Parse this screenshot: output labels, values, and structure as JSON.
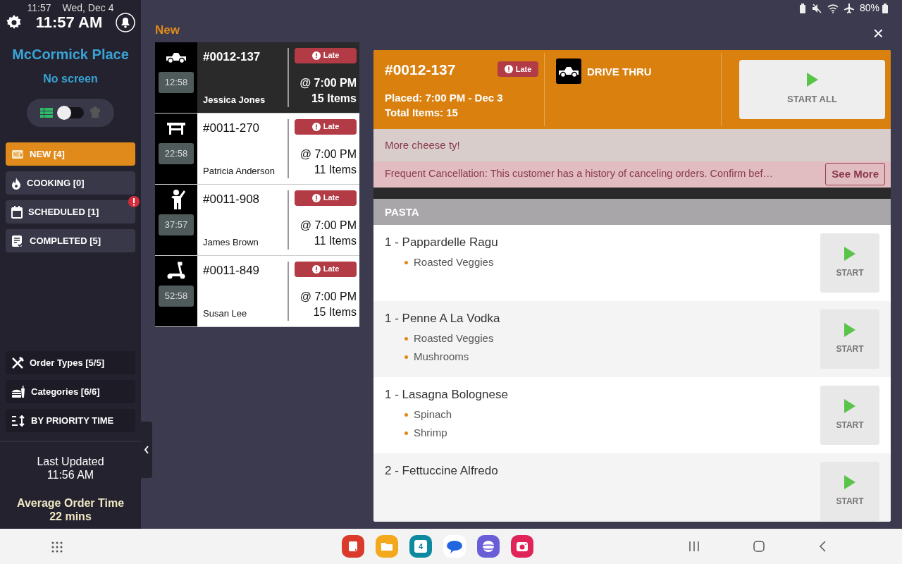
{
  "status_bar": {
    "time": "11:57",
    "date": "Wed, Dec 4",
    "battery": "80%"
  },
  "header": {
    "clock": "11:57 AM",
    "location": "McCormick Place",
    "screen": "No screen",
    "view_toggle": {
      "on": false
    }
  },
  "nav": [
    {
      "kind": "new",
      "label": "NEW [4]",
      "selected": true,
      "alert": false
    },
    {
      "kind": "cooking",
      "label": "COOKING [0]",
      "selected": false,
      "alert": false
    },
    {
      "kind": "scheduled",
      "label": "SCHEDULED [1]",
      "selected": false,
      "alert": true
    },
    {
      "kind": "completed",
      "label": "COMPLETED [5]",
      "selected": false,
      "alert": false
    }
  ],
  "filters": [
    {
      "kind": "order-types",
      "label": "Order Types [5/5]"
    },
    {
      "kind": "categories",
      "label": "Categories [6/6]"
    },
    {
      "kind": "sort",
      "label": "BY PRIORITY TIME"
    }
  ],
  "footer": {
    "last_updated_label": "Last Updated",
    "last_updated_time": "11:56 AM",
    "average_label": "Average Order Time",
    "average_value": "22 mins"
  },
  "column_title": "New",
  "orders": [
    {
      "kind": "car",
      "timer": "12:58",
      "number": "#0012-137",
      "customer": "Jessica Jones",
      "badge": "Late",
      "time": "@ 7:00 PM",
      "items": "15 Items",
      "selected": true
    },
    {
      "kind": "table",
      "timer": "22:58",
      "number": "#0011-270",
      "customer": "Patricia Anderson",
      "badge": "Late",
      "time": "@ 7:00 PM",
      "items": "11 Items",
      "selected": false
    },
    {
      "kind": "walk-in",
      "timer": "37:57",
      "number": "#0011-908",
      "customer": "James Brown",
      "badge": "Late",
      "time": "@ 7:00 PM",
      "items": "11 Items",
      "selected": false
    },
    {
      "kind": "scooter",
      "timer": "52:58",
      "number": "#0011-849",
      "customer": "Susan Lee",
      "badge": "Late",
      "time": "@ 7:00 PM",
      "items": "15 Items",
      "selected": false
    }
  ],
  "detail": {
    "close": "×",
    "number": "#0012-137",
    "badge": "Late",
    "placed": "Placed: 7:00 PM - Dec 3",
    "total": "Total Items: 15",
    "order_type": "DRIVE THRU",
    "start_all": "START ALL",
    "note": "More cheese ty!",
    "warning": "Frequent Cancellation: This customer has a history of canceling orders. Confirm bef…",
    "see_more": "See More",
    "category": "PASTA",
    "items": [
      {
        "name": "1 - Pappardelle Ragu",
        "modifiers": [
          "Roasted Veggies"
        ],
        "button": "START"
      },
      {
        "name": "1 - Penne A La Vodka",
        "modifiers": [
          "Roasted Veggies",
          "Mushrooms"
        ],
        "button": "START"
      },
      {
        "name": "1 - Lasagna Bolognese",
        "modifiers": [
          "Spinach",
          "Shrimp"
        ],
        "button": "START"
      },
      {
        "name": "2 - Fettuccine Alfredo",
        "button": "START"
      }
    ]
  },
  "dock": {
    "calendar_day": "4"
  }
}
